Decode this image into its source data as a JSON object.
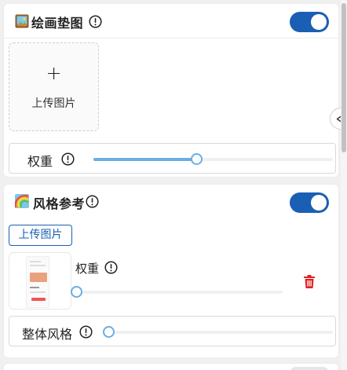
{
  "init_image_panel": {
    "title": "绘画垫图",
    "enabled": true,
    "upload": {
      "plus": "+",
      "label": "上传图片"
    },
    "weight": {
      "label": "权重",
      "value": 0.43
    }
  },
  "style_ref_panel": {
    "title": "风格参考",
    "enabled": true,
    "upload_button": "上传图片",
    "reference_item": {
      "weight_label": "权重",
      "weight_value": 0.0
    },
    "overall_style": {
      "label": "整体风格",
      "value": 0.0
    }
  },
  "icons": {
    "info": "info-circle-icon",
    "delete": "trash-icon",
    "collapse": "chevron-left-icon",
    "painting_emoji": "framed-picture-icon",
    "rainbow_emoji": "rainbow-icon"
  },
  "colors": {
    "accent": "#1a5fb4",
    "slider": "#6aaee6",
    "danger": "#e02020"
  }
}
